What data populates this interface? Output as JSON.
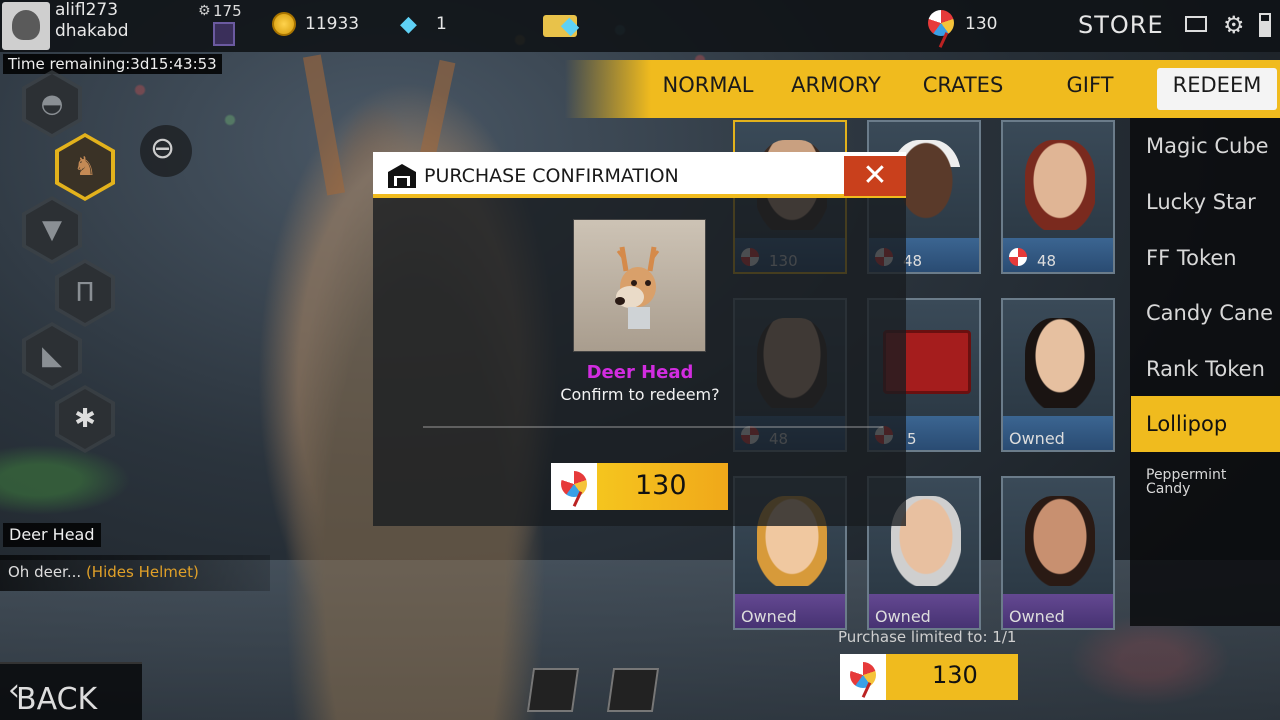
{
  "header": {
    "username": "alifl273",
    "region": "dhakabd",
    "level": "175",
    "coins": "11933",
    "diamonds": "1",
    "lollipops": "130",
    "store_label": "STORE"
  },
  "timer": "Time remaining:3d15:43:53",
  "tabs": [
    {
      "label": "NORMAL"
    },
    {
      "label": "ARMORY"
    },
    {
      "label": "CRATES"
    },
    {
      "label": "GIFT"
    },
    {
      "label": "REDEEM",
      "active": true
    }
  ],
  "categories": [
    {
      "label": "Magic Cube"
    },
    {
      "label": "Lucky Star"
    },
    {
      "label": "FF Token"
    },
    {
      "label": "Candy Cane"
    },
    {
      "label": "Rank Token"
    },
    {
      "label": "Lollipop",
      "active": true
    },
    {
      "label": "Peppermint Candy"
    }
  ],
  "grid": [
    {
      "status": "130"
    },
    {
      "status": "48"
    },
    {
      "status": "48"
    },
    {
      "status": "48"
    },
    {
      "status": "5"
    },
    {
      "status": "Owned"
    },
    {
      "status": "Owned"
    },
    {
      "status": "Owned"
    },
    {
      "status": "Owned"
    }
  ],
  "purchase_limit": "Purchase limited to: 1/1",
  "buy_price": "130",
  "item": {
    "name": "Deer Head",
    "desc_prefix": "Oh deer...",
    "desc_highlight": "(Hides Helmet)"
  },
  "back_label": "BACK",
  "modal": {
    "title": "PURCHASE CONFIRMATION",
    "item_name": "Deer Head",
    "prompt": "Confirm to redeem?",
    "price": "130",
    "close_icon": "close-icon"
  },
  "colors": {
    "accent": "#f0bb1e",
    "item_name": "#d22ce0",
    "close": "#c9401c"
  }
}
